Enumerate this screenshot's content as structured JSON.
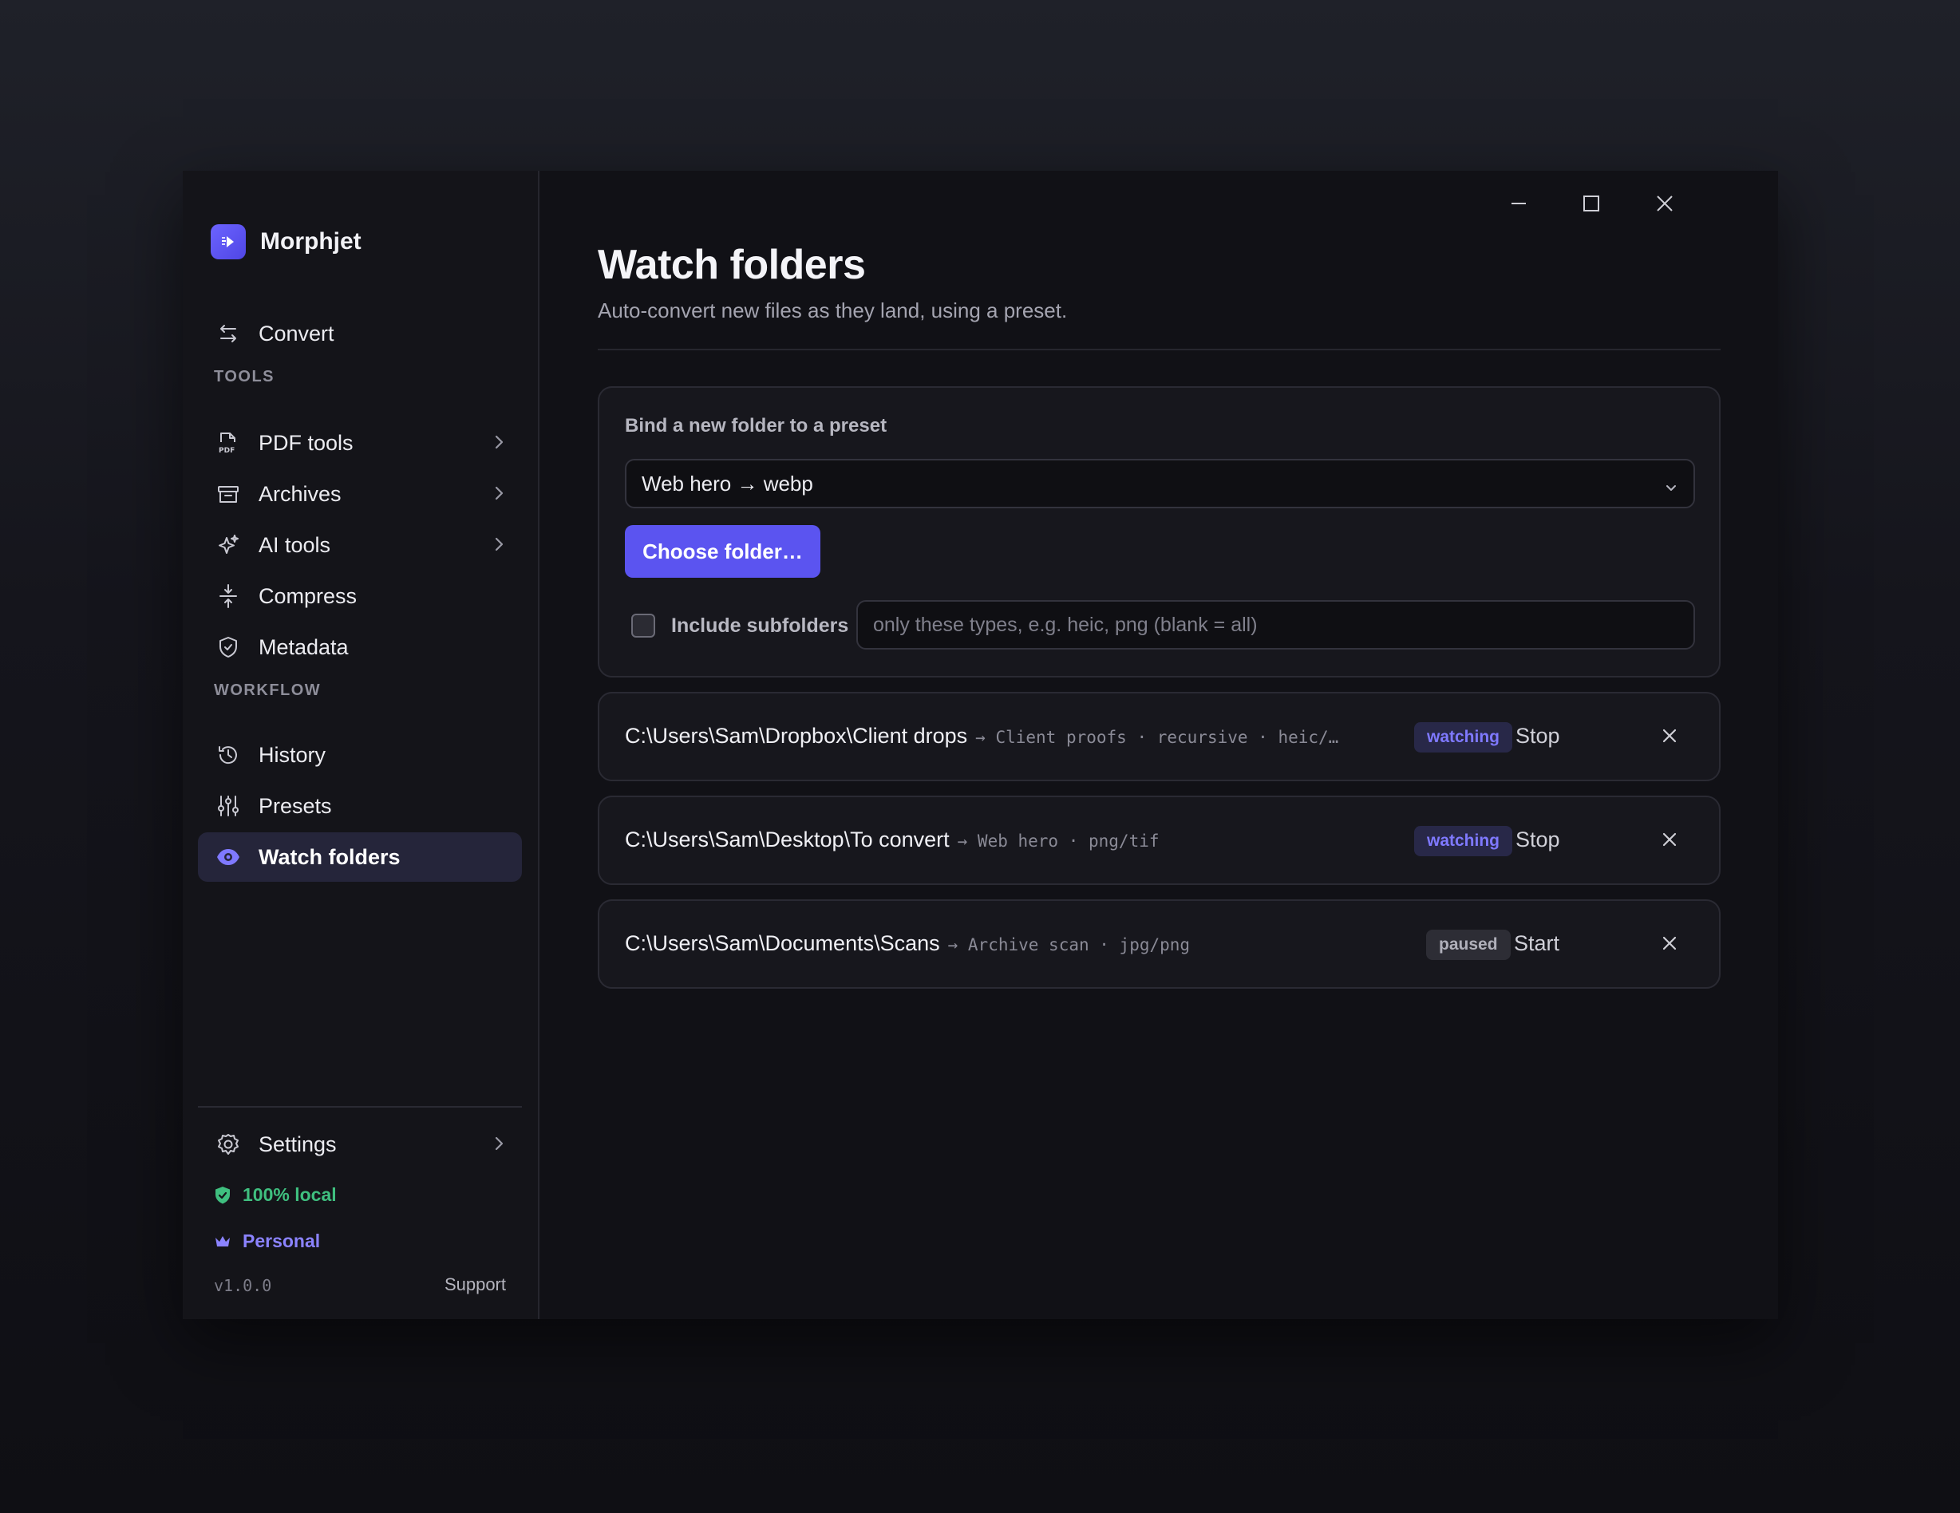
{
  "app": {
    "name": "Morphjet",
    "accent": "#5b54f0"
  },
  "sidebar": {
    "convert": {
      "label": "Convert",
      "icon": "arrows-swap-icon"
    },
    "tools_section": "TOOLS",
    "tools": [
      {
        "label": "PDF tools",
        "icon": "pdf-icon",
        "has_submenu": true
      },
      {
        "label": "Archives",
        "icon": "archive-icon",
        "has_submenu": true
      },
      {
        "label": "AI tools",
        "icon": "sparkle-icon",
        "has_submenu": true
      },
      {
        "label": "Compress",
        "icon": "compress-icon",
        "has_submenu": false
      },
      {
        "label": "Metadata",
        "icon": "shield-icon",
        "has_submenu": false
      }
    ],
    "workflow_section": "WORKFLOW",
    "workflow": [
      {
        "label": "History",
        "icon": "history-icon"
      },
      {
        "label": "Presets",
        "icon": "sliders-icon"
      },
      {
        "label": "Watch folders",
        "icon": "eye-icon",
        "active": true
      }
    ],
    "settings": {
      "label": "Settings",
      "icon": "gear-icon"
    },
    "local_status": "100% local",
    "plan": "Personal",
    "version": "v1.0.0",
    "support": "Support"
  },
  "main": {
    "title": "Watch folders",
    "subtitle": "Auto-convert new files as they land, using a preset.",
    "bind": {
      "title": "Bind a new folder to a preset",
      "preset_selected": "Web hero → webp",
      "choose_button": "Choose folder…",
      "include_subfolders_label": "Include subfolders",
      "include_subfolders_checked": false,
      "types_placeholder": "only these types, e.g. heic, png (blank = all)",
      "types_value": ""
    },
    "watches": [
      {
        "path": "C:\\Users\\Sam\\Dropbox\\Client drops",
        "meta": "→ Client proofs · recursive · heic/…",
        "status": "watching",
        "action": "Stop"
      },
      {
        "path": "C:\\Users\\Sam\\Desktop\\To convert",
        "meta": "→ Web hero · png/tif",
        "status": "watching",
        "action": "Stop"
      },
      {
        "path": "C:\\Users\\Sam\\Documents\\Scans",
        "meta": "→ Archive scan · jpg/png",
        "status": "paused",
        "action": "Start"
      }
    ]
  }
}
